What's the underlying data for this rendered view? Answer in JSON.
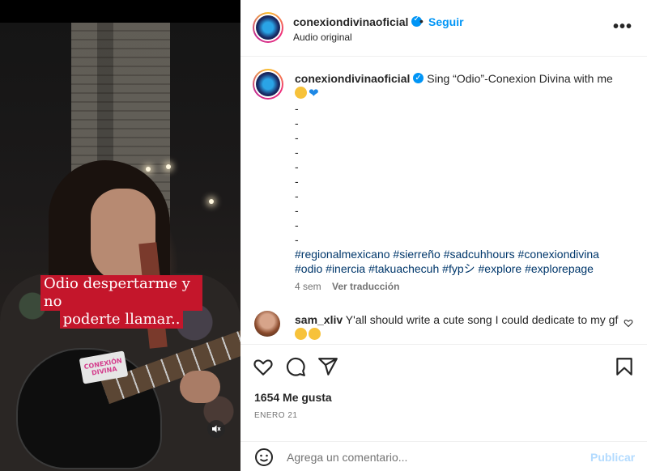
{
  "video": {
    "caption_line1": "Odio despertarme y no",
    "caption_line2": "poderte llamar..",
    "sticker_text": "CONEXIÓN DIVINA",
    "mute_icon": "speaker-mute-icon"
  },
  "header": {
    "username": "conexiondivinaoficial",
    "separator": "•",
    "follow_label": "Seguir",
    "audio_label": "Audio original",
    "more_label": "•••"
  },
  "post": {
    "username": "conexiondivinaoficial",
    "text": " Sing “Odio”-Conexion Divina with me",
    "emojis": [
      "smiling-cat-icon",
      "blue-heart-icon"
    ],
    "dashes": [
      "-",
      "-",
      "-",
      "-",
      "-",
      "-",
      "-",
      "-",
      "-",
      "-"
    ],
    "hashtags_line1": [
      "#regionalmexicano",
      "#sierreño",
      "#sadcuhhours",
      "#conexiondivina"
    ],
    "hashtags_line2": [
      "#odio",
      "#inercia",
      "#takuachecuh",
      "#fypシ",
      "#explore",
      "#explorepage"
    ],
    "age": "4 sem",
    "translate_label": "Ver traducción"
  },
  "comment": {
    "username": "sam_xliv",
    "text": " Y'all should write a cute song I could dedicate to my gf ",
    "emojis": [
      "crying-face-icon",
      "crying-face-icon"
    ]
  },
  "stats": {
    "likes": "1654 Me gusta",
    "date": "ENERO 21"
  },
  "composer": {
    "placeholder": "Agrega un comentario...",
    "publish_label": "Publicar"
  },
  "colors": {
    "link_blue": "#0095f6",
    "hashtag": "#00376b",
    "caption_bg": "#c4162b",
    "publish_disabled": "#b3dbff"
  }
}
